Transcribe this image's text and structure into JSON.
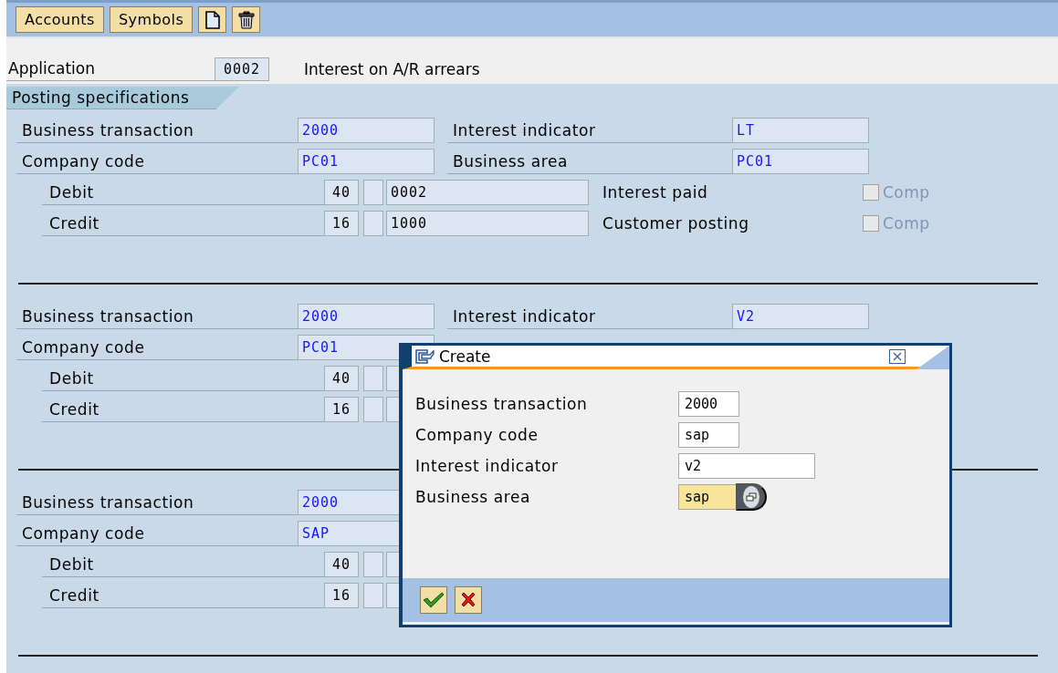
{
  "toolbar": {
    "buttons": [
      {
        "kind": "text",
        "label": "Accounts"
      },
      {
        "kind": "text",
        "label": "Symbols"
      },
      {
        "kind": "new"
      },
      {
        "kind": "delete"
      }
    ]
  },
  "application": {
    "label": "Application",
    "value": "0002",
    "description": "Interest on A/R arrears"
  },
  "section_tab": {
    "label": "Posting specifications",
    "selected": true
  },
  "blocks": [
    {
      "rows": [
        {
          "kind": "main",
          "label": "Business transaction",
          "value": "2000",
          "right_label": "Interest indicator",
          "right_value": "LT"
        },
        {
          "kind": "main",
          "label": "Company code",
          "value": "PC01",
          "right_label": "Business area",
          "right_value": "PC01"
        },
        {
          "kind": "posting",
          "label": "Debit",
          "key": "40",
          "account": "0002",
          "right_label": "Interest paid",
          "checkbox": {
            "label": "Comp",
            "checked": false,
            "disabled": true
          }
        },
        {
          "kind": "posting",
          "label": "Credit",
          "key": "16",
          "account": "1000",
          "right_label": "Customer posting",
          "checkbox": {
            "label": "Comp",
            "checked": false,
            "disabled": true
          }
        }
      ]
    },
    {
      "rows": [
        {
          "kind": "main",
          "label": "Business transaction",
          "value": "2000",
          "right_label": "Interest indicator",
          "right_value": "V2"
        },
        {
          "kind": "main",
          "label": "Company code",
          "value": "PC01"
        },
        {
          "kind": "posting",
          "label": "Debit",
          "key": "40"
        },
        {
          "kind": "posting",
          "label": "Credit",
          "key": "16"
        }
      ]
    },
    {
      "rows": [
        {
          "kind": "main",
          "label": "Business transaction",
          "value": "2000"
        },
        {
          "kind": "main",
          "label": "Company code",
          "value": "SAP"
        },
        {
          "kind": "posting",
          "label": "Debit",
          "key": "40"
        },
        {
          "kind": "posting",
          "label": "Credit",
          "key": "16"
        }
      ]
    }
  ],
  "dialog": {
    "title": "Create",
    "fields": [
      {
        "label": "Business transaction",
        "value": "2000",
        "focused": false
      },
      {
        "label": "Company code",
        "value": "sap",
        "focused": false
      },
      {
        "label": "Interest indicator",
        "value": "v2",
        "focused": false
      },
      {
        "label": "Business area",
        "value": "sap",
        "focused": true
      }
    ],
    "buttons": [
      {
        "kind": "confirm"
      },
      {
        "kind": "cancel"
      }
    ]
  }
}
